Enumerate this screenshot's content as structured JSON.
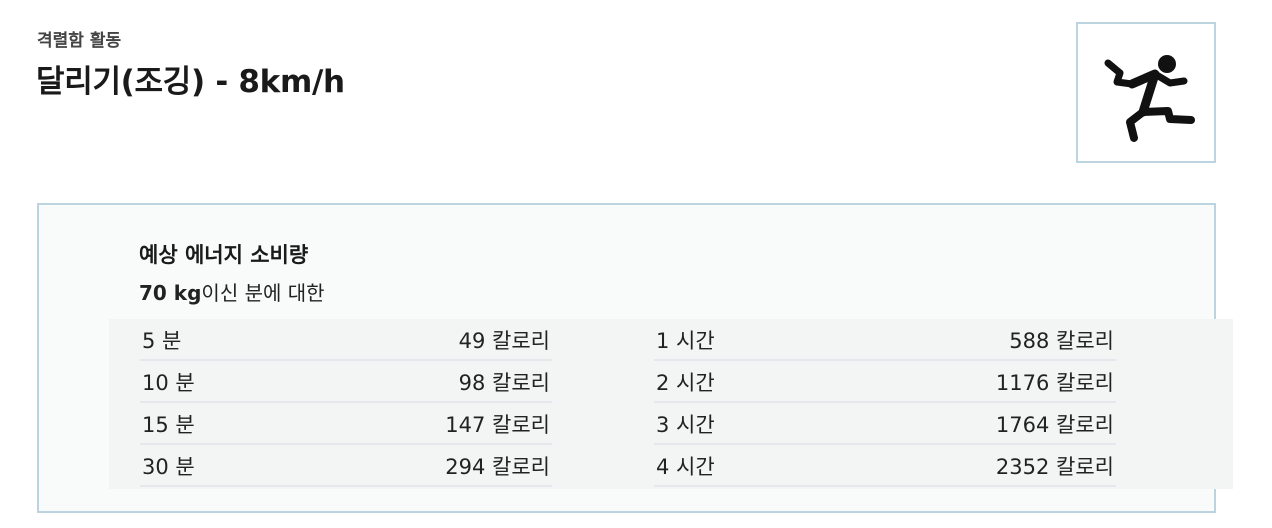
{
  "header": {
    "category": "격렬함 활동",
    "title": "달리기(조깅) - 8km/h",
    "icon": "running-person-icon"
  },
  "energy": {
    "title": "예상 에너지 소비량",
    "weight": "70 kg",
    "subtitle_suffix": "이신 분에 대한",
    "left_rows": [
      {
        "label": "5 분",
        "value": "49 칼로리"
      },
      {
        "label": "10 분",
        "value": "98 칼로리"
      },
      {
        "label": "15 분",
        "value": "147 칼로리"
      },
      {
        "label": "30 분",
        "value": "294 칼로리"
      }
    ],
    "right_rows": [
      {
        "label": "1 시간",
        "value": "588 칼로리"
      },
      {
        "label": "2 시간",
        "value": "1176 칼로리"
      },
      {
        "label": "3 시간",
        "value": "1764 칼로리"
      },
      {
        "label": "4 시간",
        "value": "2352 칼로리"
      }
    ]
  },
  "colors": {
    "border": "#bcd3e0",
    "panel_bg": "#f9fbfb",
    "row_divider": "#e4e8ec"
  }
}
